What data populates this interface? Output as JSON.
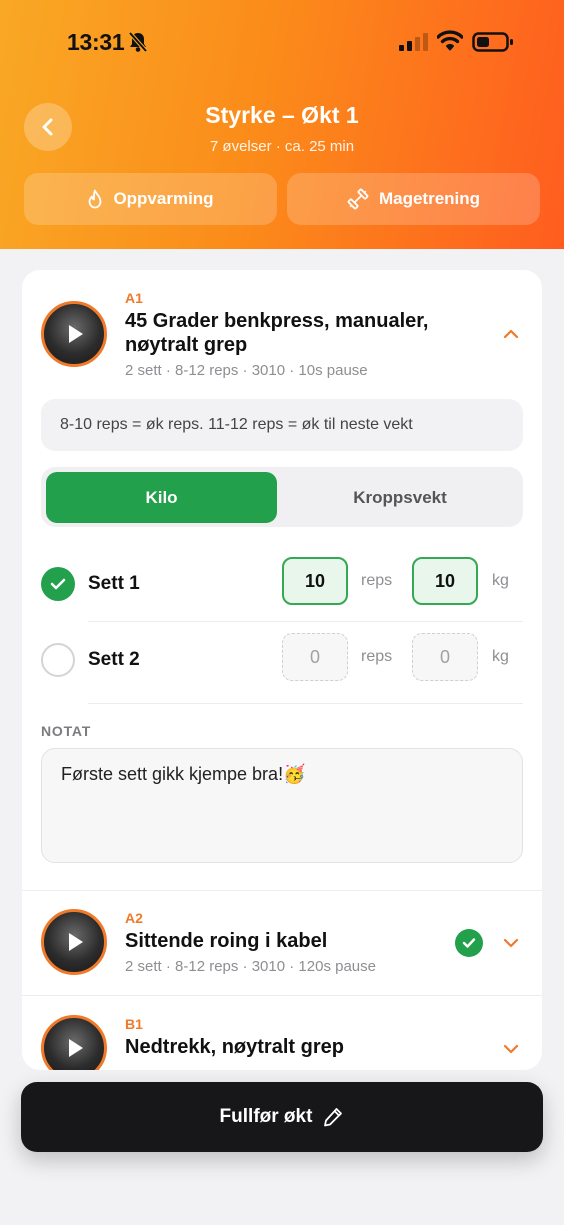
{
  "status_bar": {
    "time": "13:31"
  },
  "header": {
    "title": "Styrke – Økt 1",
    "subtitle": "7 øvelser · ca. 25 min",
    "buttons": {
      "warmup": "Oppvarming",
      "core": "Magetrening"
    }
  },
  "exercises": [
    {
      "code": "A1",
      "name_line1": "45 Grader benkpress, manualer,",
      "name_line2": "nøytralt grep",
      "meta": "2 sett · 8-12 reps · 3010 · 10s pause",
      "expanded": true,
      "tip": "8-10 reps = øk reps. 11-12 reps = øk til neste vekt",
      "toggle": {
        "active": "Kilo",
        "inactive": "Kroppsvekt"
      },
      "sets": [
        {
          "label": "Sett 1",
          "reps": "10",
          "weight": "10",
          "completed": true
        },
        {
          "label": "Sett 2",
          "reps": "0",
          "weight": "0",
          "completed": false
        }
      ],
      "units": {
        "reps": "reps",
        "weight": "kg"
      },
      "note_label": "NOTAT",
      "note": "Første sett gikk kjempe bra!🥳"
    },
    {
      "code": "A2",
      "name": "Sittende roing i kabel",
      "meta": "2 sett · 8-12 reps · 3010 · 120s pause",
      "completed": true
    },
    {
      "code": "B1",
      "name": "Nedtrekk, nøytralt grep"
    }
  ],
  "footer": {
    "finish_label": "Fullfør økt"
  },
  "colors": {
    "accent_orange": "#f07a2a",
    "success_green": "#22a04b",
    "dark_button": "#17171a"
  }
}
